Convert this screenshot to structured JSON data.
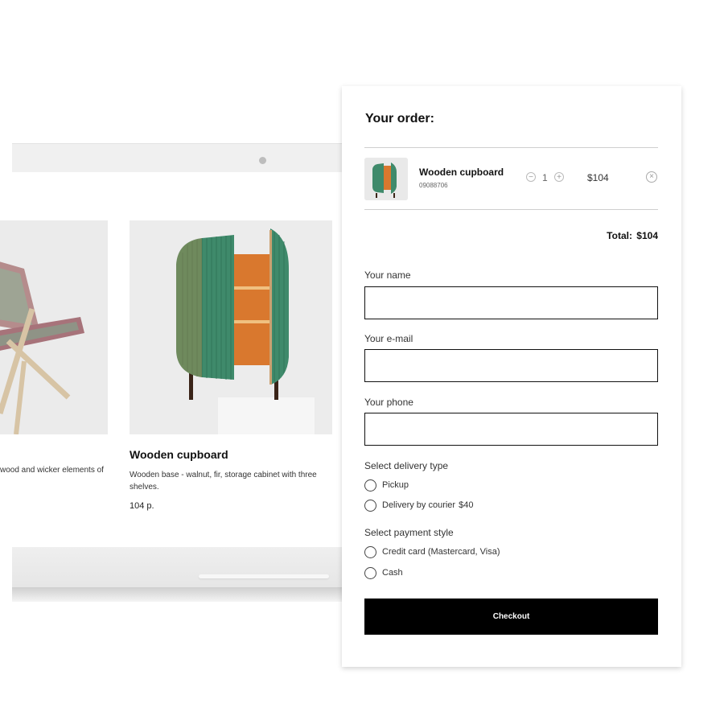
{
  "products": [
    {
      "title": "",
      "description": "wood and wicker elements of",
      "price": ""
    },
    {
      "title": "Wooden cupboard",
      "description": "Wooden base - walnut, fir, storage cabinet with three shelves.",
      "price": "104 р."
    }
  ],
  "order": {
    "title": "Your order:",
    "item": {
      "name": "Wooden cupboard",
      "sku": "09088706",
      "quantity": "1",
      "price": "$104",
      "minus_icon": "minus-circle-icon",
      "plus_icon": "plus-circle-icon",
      "remove_icon": "close-circle-icon"
    },
    "total_label": "Total:",
    "total_value": "$104"
  },
  "form": {
    "name_label": "Your name",
    "name_value": "",
    "email_label": "Your e-mail",
    "email_value": "",
    "phone_label": "Your phone",
    "phone_value": "",
    "delivery_label": "Select delivery type",
    "delivery_options": [
      {
        "label": "Pickup",
        "extra": ""
      },
      {
        "label": "Delivery by courier",
        "extra": "$40"
      }
    ],
    "payment_label": "Select payment style",
    "payment_options": [
      {
        "label": "Credit card (Mastercard, Visa)"
      },
      {
        "label": "Cash"
      }
    ],
    "checkout_label": "Checkout"
  },
  "colors": {
    "button_bg": "#000000",
    "cabinet_green": "#3f8a6b",
    "cabinet_interior": "#d9782e"
  }
}
